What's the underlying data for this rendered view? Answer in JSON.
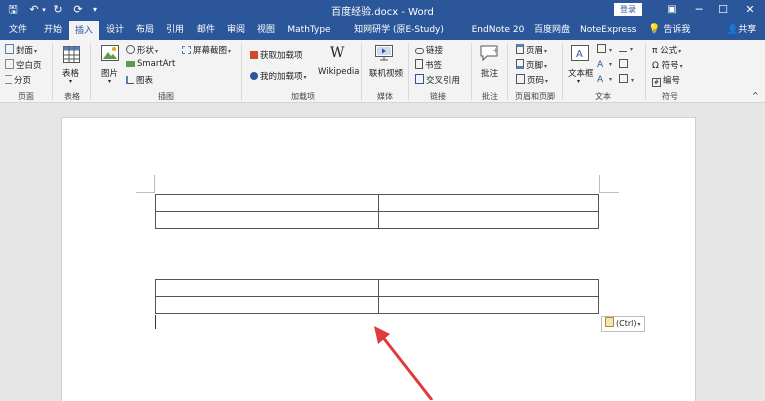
{
  "window": {
    "title": "百度经验.docx - Word",
    "login_label": "登录",
    "minimize": "─",
    "maximize": "☐",
    "close": "✕",
    "ribbon_toggle": "▣"
  },
  "qat": {
    "save": "🖫",
    "undo": "↶",
    "undo_dd": "▾",
    "redo": "↻",
    "customize": "▾"
  },
  "tabs": [
    "文件",
    "开始",
    "插入",
    "设计",
    "布局",
    "引用",
    "邮件",
    "审阅",
    "视图",
    "MathType",
    "知网研学 (原E-Study)",
    "EndNote 20",
    "百度网盘",
    "NoteExpress"
  ],
  "tell_me": "告诉我",
  "share": "共享",
  "ribbon": {
    "pages": {
      "cover": "封面",
      "blank": "空白页",
      "break": "分页",
      "label": "页面"
    },
    "tables": {
      "table": "表格",
      "label": "表格"
    },
    "illustrations": {
      "pictures": "图片",
      "shapes": "形状",
      "smartart": "SmartArt",
      "chart": "图表",
      "screenshot": "屏幕截图",
      "label": "插图"
    },
    "addins": {
      "get": "获取加载项",
      "my": "我的加载项",
      "wikipedia": "Wikipedia",
      "label": "加载项"
    },
    "media": {
      "video": "联机视频",
      "label": "媒体"
    },
    "links": {
      "link": "链接",
      "bookmark": "书签",
      "crossref": "交叉引用",
      "label": "链接"
    },
    "comments": {
      "comment": "批注",
      "label": "批注"
    },
    "header_footer": {
      "header": "页眉",
      "footer": "页脚",
      "page_number": "页码",
      "label": "页眉和页脚"
    },
    "text": {
      "textbox": "文本框",
      "label": "文本"
    },
    "symbols": {
      "equation": "公式",
      "symbol": "符号",
      "numbering": "编号",
      "label": "符号"
    }
  },
  "paste_options": {
    "label": "(Ctrl)"
  },
  "tables": [
    {
      "rows": [
        [
          "",
          ""
        ],
        [
          "",
          ""
        ]
      ]
    },
    {
      "rows": [
        [
          "",
          ""
        ],
        [
          "",
          ""
        ]
      ]
    }
  ],
  "colors": {
    "accent": "#2b579a",
    "arrow": "#e03a3a"
  }
}
